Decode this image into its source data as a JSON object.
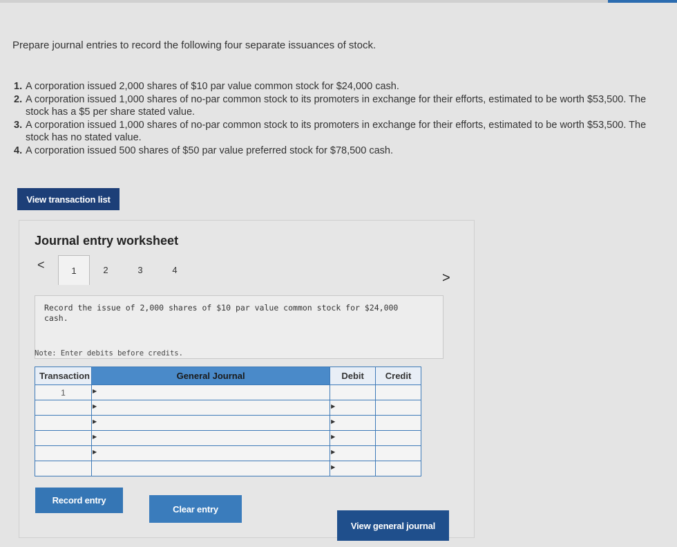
{
  "instructions": "Prepare journal entries to record the following four separate issuances of stock.",
  "tasks": [
    {
      "num": "1.",
      "text": "A corporation issued 2,000 shares of $10 par value common stock for $24,000 cash."
    },
    {
      "num": "2.",
      "text": "A corporation issued 1,000 shares of no-par common stock to its promoters in exchange for their efforts, estimated to be worth $53,500. The stock has a $5 per share stated value."
    },
    {
      "num": "3.",
      "text": "A corporation issued 1,000 shares of no-par common stock to its promoters in exchange for their efforts, estimated to be worth $53,500. The stock has no stated value."
    },
    {
      "num": "4.",
      "text": "A corporation issued 500 shares of $50 par value preferred stock for $78,500 cash."
    }
  ],
  "buttons": {
    "view_transaction_list": "View transaction list",
    "record_entry": "Record entry",
    "clear_entry": "Clear entry",
    "view_general_journal": "View general journal"
  },
  "worksheet": {
    "title": "Journal entry worksheet",
    "tabs": [
      "1",
      "2",
      "3",
      "4"
    ],
    "prev": "<",
    "next": ">",
    "description": "Record the issue of 2,000 shares of $10 par value common stock for $24,000 cash.",
    "note": "Note: Enter debits before credits."
  },
  "journal": {
    "headers": {
      "transaction": "Transaction",
      "general_journal": "General Journal",
      "debit": "Debit",
      "credit": "Credit"
    },
    "rows": [
      {
        "transaction": "1"
      },
      {
        "transaction": ""
      },
      {
        "transaction": ""
      },
      {
        "transaction": ""
      },
      {
        "transaction": ""
      },
      {
        "transaction": ""
      }
    ]
  },
  "colors": {
    "button_dark": "#1d3f78",
    "button_light": "#3576b5",
    "table_header": "#4a8ac9"
  }
}
